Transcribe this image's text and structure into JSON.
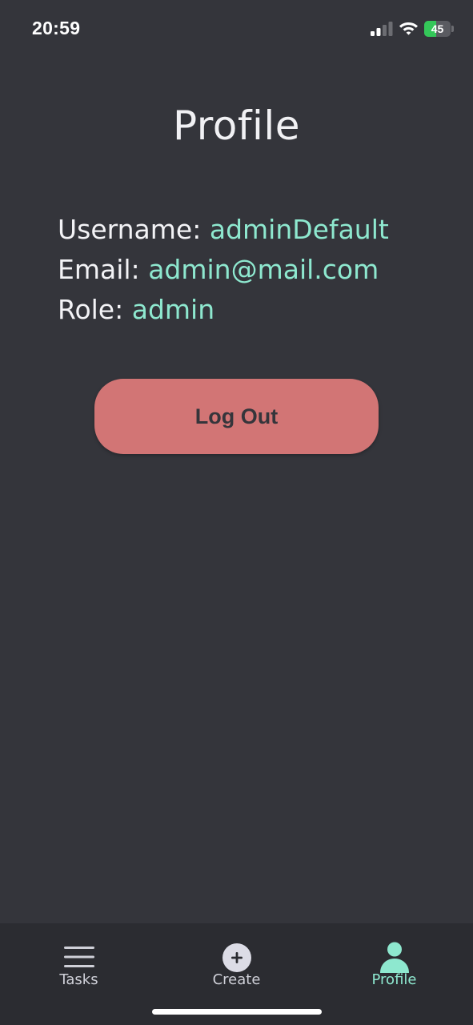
{
  "status_bar": {
    "time": "20:59",
    "battery_level": "45",
    "battery_fraction": 0.45,
    "icons": [
      "signal-icon",
      "wifi-icon",
      "battery-icon"
    ]
  },
  "page": {
    "title": "Profile"
  },
  "profile": {
    "username_label": "Username:",
    "username_value": "adminDefault",
    "email_label": "Email:",
    "email_value": "admin@mail.com",
    "role_label": "Role:",
    "role_value": "admin"
  },
  "actions": {
    "logout_label": "Log Out"
  },
  "tab_bar": {
    "tabs": [
      {
        "label": "Tasks",
        "icon": "menu-icon",
        "active": false
      },
      {
        "label": "Create",
        "icon": "plus-circle-icon",
        "active": false
      },
      {
        "label": "Profile",
        "icon": "user-icon",
        "active": true
      }
    ]
  },
  "colors": {
    "background": "#34353b",
    "tab_bar_background": "#2b2c31",
    "accent": "#8ee8cf",
    "logout_button": "#d27575",
    "text_primary": "#f3f3f6",
    "battery_green": "#34c759"
  }
}
